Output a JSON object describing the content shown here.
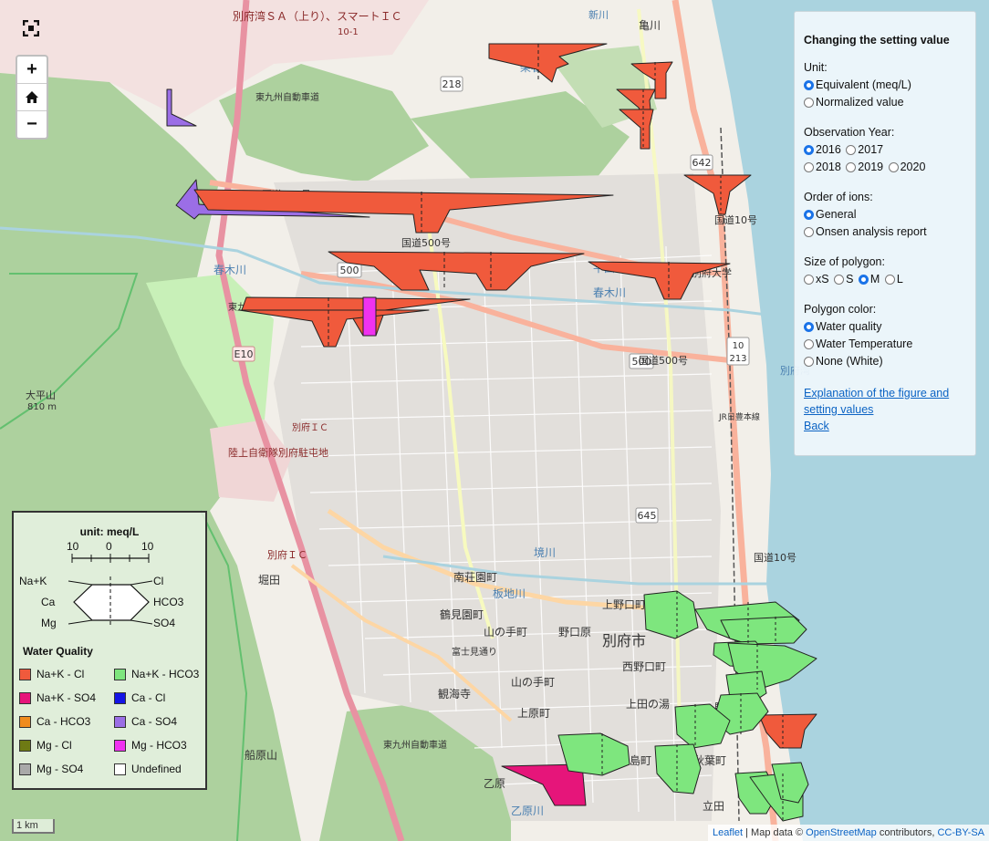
{
  "map": {
    "labels": [
      {
        "id": "sa",
        "text": "別府湾ＳＡ（上り）、スマートＩＣ"
      },
      {
        "id": "sa2",
        "text": "10-1"
      },
      {
        "id": "kamegawa",
        "text": "亀川"
      },
      {
        "id": "shibaseki",
        "text": "柴石川"
      },
      {
        "id": "r218",
        "text": "218"
      },
      {
        "id": "r642",
        "text": "642"
      },
      {
        "id": "r500a",
        "text": "500"
      },
      {
        "id": "r500b",
        "text": "500"
      },
      {
        "id": "e10",
        "text": "E10"
      },
      {
        "id": "r10",
        "text": "10"
      },
      {
        "id": "r213",
        "text": "213"
      },
      {
        "id": "r645",
        "text": "645"
      },
      {
        "id": "harukigawa",
        "text": "春木川"
      },
      {
        "id": "harukigawa2",
        "text": "春木川"
      },
      {
        "id": "heida",
        "text": "平田"
      },
      {
        "id": "oohirayama",
        "text": "大平山"
      },
      {
        "id": "oohirayama2",
        "text": "810 m"
      },
      {
        "id": "jieitai",
        "text": "陸上自衛隊別府駐屯地"
      },
      {
        "id": "beppuic",
        "text": "別府ＩＣ"
      },
      {
        "id": "beppuic2",
        "text": "別府ＩＣ"
      },
      {
        "id": "horita",
        "text": "堀田"
      },
      {
        "id": "minamisou",
        "text": "南荘園町"
      },
      {
        "id": "tsurumi",
        "text": "鶴見園町"
      },
      {
        "id": "yamanote",
        "text": "山の手町"
      },
      {
        "id": "yamanote2",
        "text": "山の手町"
      },
      {
        "id": "noguchi",
        "text": "野口原"
      },
      {
        "id": "beppushi",
        "text": "別府市"
      },
      {
        "id": "nishinoguchi",
        "text": "西野口町"
      },
      {
        "id": "kaminoguchi",
        "text": "上野口町"
      },
      {
        "id": "kanmikai",
        "text": "観海寺"
      },
      {
        "id": "uehara",
        "text": "上原町"
      },
      {
        "id": "ueda",
        "text": "上田の湯"
      },
      {
        "id": "harahara",
        "text": "原町"
      },
      {
        "id": "otohara",
        "text": "乙原"
      },
      {
        "id": "funahara",
        "text": "船原山"
      },
      {
        "id": "shimacho",
        "text": "島町"
      },
      {
        "id": "akiba",
        "text": "秋葉町"
      },
      {
        "id": "tateda",
        "text": "立田"
      },
      {
        "id": "sakaigawa",
        "text": "境川"
      },
      {
        "id": "itaji",
        "text": "板地川"
      },
      {
        "id": "fujimi",
        "text": "富士見通り"
      },
      {
        "id": "r500c",
        "text": "国道500号"
      },
      {
        "id": "r500d",
        "text": "国道500号"
      },
      {
        "id": "r500e",
        "text": "国道500号"
      },
      {
        "id": "r10go",
        "text": "国道10号"
      },
      {
        "id": "r10go2",
        "text": "国道10号"
      },
      {
        "id": "higashikyushu",
        "text": "東九州自動車道"
      },
      {
        "id": "higashikyushu2",
        "text": "東九州自動車道"
      },
      {
        "id": "higashikyushu3",
        "text": "東九州自動車道"
      },
      {
        "id": "otoharagawa",
        "text": "乙原川"
      },
      {
        "id": "beppudaigaku",
        "text": "別府大学"
      },
      {
        "id": "shinkawa",
        "text": "新川"
      },
      {
        "id": "eki",
        "text": "駅"
      },
      {
        "id": "jr",
        "text": "JR日豊本線"
      },
      {
        "id": "beppuwan",
        "text": "別府湾"
      }
    ]
  },
  "controls": {
    "zoom_in": "+",
    "home": "⌂",
    "zoom_out": "−"
  },
  "panel": {
    "title": "Changing the setting value",
    "unit": {
      "label": "Unit:",
      "options": [
        "Equivalent (meq/L)",
        "Normalized value"
      ],
      "selected": 0
    },
    "year": {
      "label": "Observation Year:",
      "options": [
        "2016",
        "2017",
        "2018",
        "2019",
        "2020"
      ],
      "selected": 0
    },
    "order": {
      "label": "Order of ions:",
      "options": [
        "General",
        "Onsen analysis report"
      ],
      "selected": 0
    },
    "size": {
      "label": "Size of polygon:",
      "options": [
        "xS",
        "S",
        "M",
        "L"
      ],
      "selected": 2
    },
    "color": {
      "label": "Polygon color:",
      "options": [
        "Water quality",
        "Water Temperature",
        "None (White)"
      ],
      "selected": 0
    },
    "explanation_link": "Explanation of the figure and setting values",
    "back_link": "Back"
  },
  "legend": {
    "unit_title": "unit: meq/L",
    "scale_left": "10",
    "scale_mid": "0",
    "scale_right": "10",
    "left_ions": [
      "Na+K",
      "Ca",
      "Mg"
    ],
    "right_ions": [
      "Cl",
      "HCO3",
      "SO4"
    ],
    "wq_title": "Water Quality",
    "items": [
      {
        "label": "Na+K - Cl",
        "color": "#f05a3c"
      },
      {
        "label": "Na+K - HCO3",
        "color": "#7ee67e"
      },
      {
        "label": "Na+K - SO4",
        "color": "#e6157a"
      },
      {
        "label": "Ca - Cl",
        "color": "#1414e6"
      },
      {
        "label": "Ca - HCO3",
        "color": "#f08c1e"
      },
      {
        "label": "Ca - SO4",
        "color": "#9b6ee6"
      },
      {
        "label": "Mg - Cl",
        "color": "#6e7a14"
      },
      {
        "label": "Mg - HCO3",
        "color": "#f032f0"
      },
      {
        "label": "Mg - SO4",
        "color": "#a9a9a9"
      },
      {
        "label": "Undefined",
        "color": "#ffffff"
      }
    ]
  },
  "scale_bar": "1 km",
  "attribution": {
    "leaflet": "Leaflet",
    "sep": " | Map data © ",
    "osm": "OpenStreetMap",
    "contrib": " contributors, ",
    "license": "CC-BY-SA"
  }
}
